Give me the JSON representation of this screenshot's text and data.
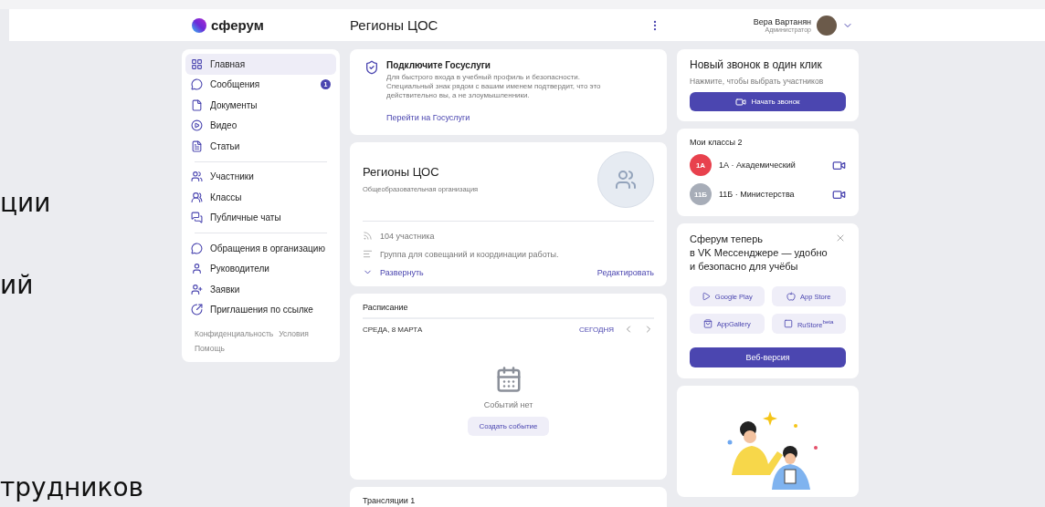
{
  "header": {
    "logo": "сферум",
    "title": "Регионы ЦОС",
    "user": {
      "name": "Вера Вартанян",
      "role": "Администратор"
    }
  },
  "sidebar": {
    "groups": [
      [
        {
          "label": "Главная",
          "selected": true
        },
        {
          "label": "Сообщения",
          "selected": false,
          "badge": "1"
        },
        {
          "label": "Документы",
          "selected": false
        },
        {
          "label": "Видео",
          "selected": false
        },
        {
          "label": "Статьи",
          "selected": false
        }
      ],
      [
        {
          "label": "Участники",
          "selected": false
        },
        {
          "label": "Классы",
          "selected": false
        },
        {
          "label": "Публичные чаты",
          "selected": false
        }
      ],
      [
        {
          "label": "Обращения в организацию",
          "selected": false
        },
        {
          "label": "Руководители",
          "selected": false
        },
        {
          "label": "Заявки",
          "selected": false
        },
        {
          "label": "Приглашения по ссылке",
          "selected": false
        }
      ]
    ],
    "footer_links": [
      "Конфиденциальность",
      "Условия",
      "Помощь"
    ]
  },
  "gosuslugi": {
    "title": "Подключите Госуслуги",
    "text": "Для быстрого входа в учебный профиль и безопасности. Специальный знак рядом с вашим именем подтвердит, что это действительно вы, а не злоумышленники.",
    "link": "Перейти на Госуслуги"
  },
  "organization": {
    "name": "Регионы ЦОС",
    "type": "Общеобразовательная организация",
    "members": "104 участника",
    "description": "Группа для совещаний и координации работы.",
    "expand": "Развернуть",
    "edit": "Редактировать"
  },
  "schedule": {
    "title": "Расписание",
    "date": "СРЕДА, 8 МАРТА",
    "today": "СЕГОДНЯ",
    "empty": "Событий нет",
    "create": "Создать событие"
  },
  "broadcasts": {
    "title": "Трансляции 1"
  },
  "call": {
    "title": "Новый звонок в один клик",
    "hint": "Нажмите, чтобы выбрать участников",
    "button": "Начать звонок"
  },
  "classes": {
    "title": "Мои классы 2",
    "items": [
      {
        "badge": "1А",
        "name": "1А · Академический",
        "color": "#e8414d"
      },
      {
        "badge": "11Б",
        "name": "11Б · Министерства",
        "color": "#a7adb8"
      }
    ]
  },
  "promo": {
    "text_lines": [
      "Сферум теперь",
      "в VK Мессенджере — удобно",
      "и безопасно для учёбы"
    ],
    "stores": [
      "Google Play",
      "App Store",
      "AppGallery",
      "RuStore$^{beta}$"
    ],
    "web": "Веб-версия"
  },
  "fragments": [
    "ции",
    "ий",
    "трудников"
  ]
}
